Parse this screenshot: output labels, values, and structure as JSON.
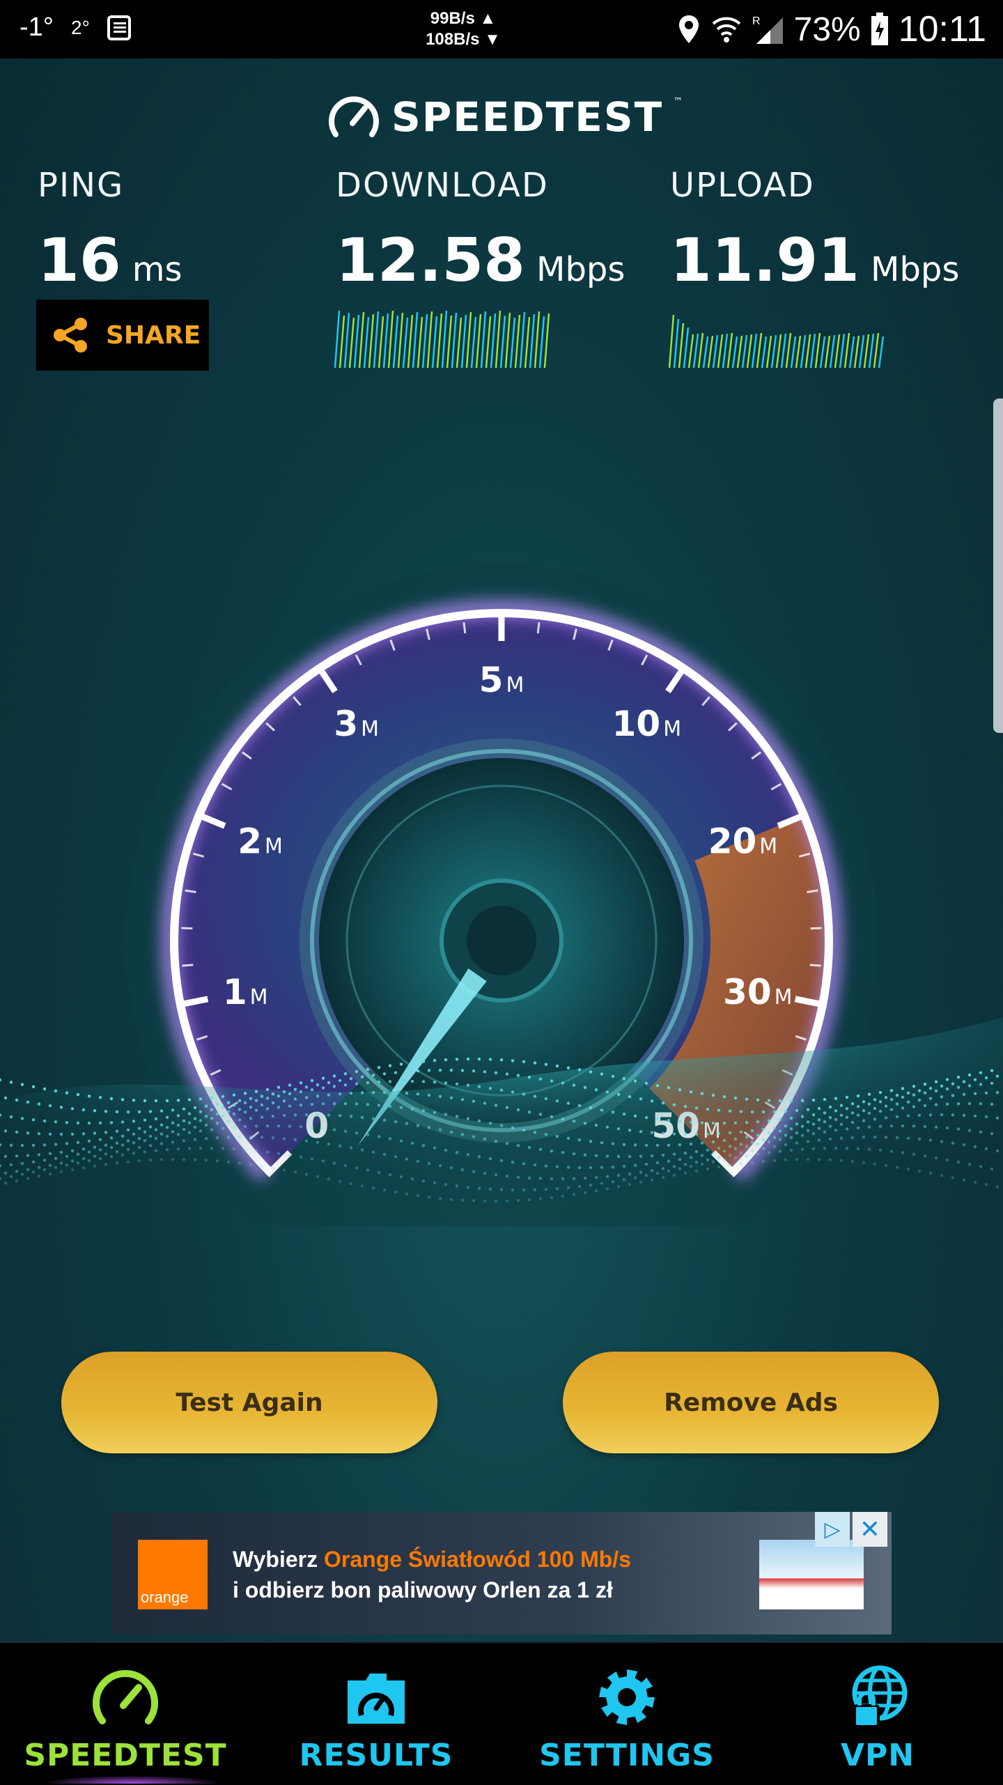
{
  "status_bar": {
    "temp_current": "-1°",
    "temp_secondary": "2°",
    "rate_up": "99B/s",
    "rate_down": "108B/s",
    "battery": "73%",
    "time": "10:11",
    "icons": [
      "location-icon",
      "wifi-icon",
      "signal-icon",
      "battery-icon"
    ]
  },
  "header": {
    "logo_text": "SPEEDTEST",
    "trademark": "™"
  },
  "metrics": {
    "ping": {
      "label": "PING",
      "value": "16",
      "unit": "ms"
    },
    "download": {
      "label": "DOWNLOAD",
      "value": "12.58",
      "unit": "Mbps"
    },
    "upload": {
      "label": "UPLOAD",
      "value": "11.91",
      "unit": "Mbps"
    }
  },
  "share": {
    "label": "SHARE"
  },
  "gauge": {
    "ticks": [
      {
        "num": "0",
        "unit": ""
      },
      {
        "num": "1",
        "unit": "M"
      },
      {
        "num": "2",
        "unit": "M"
      },
      {
        "num": "3",
        "unit": "M"
      },
      {
        "num": "5",
        "unit": "M"
      },
      {
        "num": "10",
        "unit": "M"
      },
      {
        "num": "20",
        "unit": "M"
      },
      {
        "num": "30",
        "unit": "M"
      },
      {
        "num": "50",
        "unit": "M"
      }
    ],
    "needle_value_mbps": 0
  },
  "buttons": {
    "test_again": "Test Again",
    "remove_ads": "Remove Ads"
  },
  "ad": {
    "line1_prefix": "Wybierz ",
    "line1_highlight": "Orange Światłowód 100 Mb/s",
    "line2": "i odbierz bon paliwowy Orlen za 1 zł",
    "logo_text": "orange",
    "close": "✕",
    "choices": "▷"
  },
  "nav": [
    {
      "label": "SPEEDTEST",
      "icon": "speedometer-icon",
      "active": true
    },
    {
      "label": "RESULTS",
      "icon": "results-folder-icon",
      "active": false
    },
    {
      "label": "SETTINGS",
      "icon": "gear-icon",
      "active": false
    },
    {
      "label": "VPN",
      "icon": "vpn-globe-lock-icon",
      "active": false
    }
  ],
  "colors": {
    "accent_orange": "#f5a623",
    "accent_green": "#9be23a",
    "accent_cyan": "#1fc6ef",
    "button_gold": "#e7b634"
  }
}
